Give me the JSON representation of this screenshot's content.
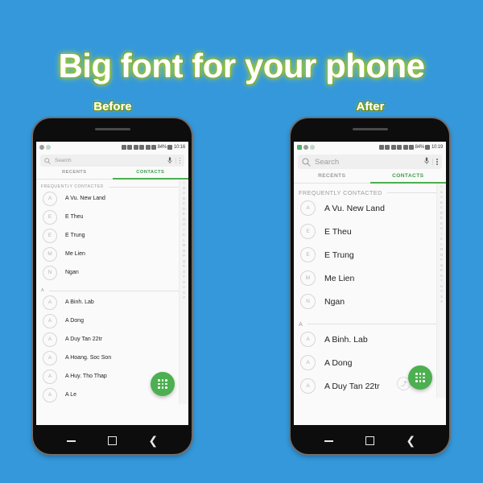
{
  "banner": {
    "title": "Big font for your phone",
    "background_color": "#3498db",
    "title_color": "#ffffff",
    "title_glow_color": "#9acd32"
  },
  "captions": {
    "before": "Before",
    "after": "After"
  },
  "phones": [
    {
      "id": "before",
      "caption": "Before",
      "status_bar": {
        "battery": "84%",
        "time": "10:16",
        "left_icons": [
          "sim-icon",
          "battery-saver-icon"
        ],
        "right_icons": [
          "no-sound-icon",
          "settings-icon",
          "wifi-icon",
          "sd-card-icon",
          "screenshot-icon",
          "signal-icon"
        ]
      },
      "search": {
        "placeholder": "Search",
        "icons": [
          "search-icon",
          "mic-icon",
          "overflow-menu-icon"
        ]
      },
      "tabs": [
        {
          "label": "RECENTS",
          "active": false
        },
        {
          "label": "CONTACTS",
          "active": true
        }
      ],
      "accent_color": "#4caf50",
      "sections": [
        {
          "header": "FREQUENTLY CONTACTED",
          "contacts": [
            {
              "initial": "A",
              "name": "A Vu. New Land"
            },
            {
              "initial": "E",
              "name": "E Theu"
            },
            {
              "initial": "E",
              "name": "E Trung"
            },
            {
              "initial": "M",
              "name": "Me Lien"
            },
            {
              "initial": "N",
              "name": "Ngan"
            }
          ]
        },
        {
          "header": "A",
          "contacts": [
            {
              "initial": "A",
              "name": "A Binh. Lab"
            },
            {
              "initial": "A",
              "name": "A Dong"
            },
            {
              "initial": "A",
              "name": "A Duy Tan 22tr"
            },
            {
              "initial": "A",
              "name": "A Hoang. Soc Son"
            },
            {
              "initial": "A",
              "name": "A Huy. Tho Thap"
            },
            {
              "initial": "A",
              "name": "A Le"
            }
          ]
        }
      ],
      "alpha_index": [
        "☆",
        "&",
        "A",
        "B",
        "C",
        "D",
        "E",
        "G",
        "H",
        "I",
        "K",
        "L",
        "M",
        "N",
        "P",
        "Q",
        "R",
        "S",
        "T",
        "U",
        "V",
        "X",
        "#"
      ],
      "fab": {
        "icon": "dialpad-icon",
        "color": "#4caf50"
      },
      "nav_bar": [
        "recents-button",
        "home-button",
        "back-button"
      ],
      "scroll_pill": null
    },
    {
      "id": "after",
      "caption": "After",
      "status_bar": {
        "battery": "84%",
        "time": "10:19",
        "left_icons": [
          "app-icon",
          "sim-icon",
          "battery-saver-icon"
        ],
        "right_icons": [
          "no-sound-icon",
          "settings-icon",
          "wifi-icon",
          "sd-card-icon",
          "screenshot-icon",
          "signal-icon"
        ]
      },
      "search": {
        "placeholder": "Search",
        "icons": [
          "search-icon",
          "mic-icon",
          "overflow-menu-icon"
        ]
      },
      "tabs": [
        {
          "label": "RECENTS",
          "active": false
        },
        {
          "label": "CONTACTS",
          "active": true
        }
      ],
      "accent_color": "#4caf50",
      "sections": [
        {
          "header": "FREQUENTLY CONTACTED",
          "contacts": [
            {
              "initial": "A",
              "name": "A Vu. New Land"
            },
            {
              "initial": "E",
              "name": "E Theu"
            },
            {
              "initial": "E",
              "name": "E Trung"
            },
            {
              "initial": "M",
              "name": "Me Lien"
            },
            {
              "initial": "N",
              "name": "Ngan"
            }
          ]
        },
        {
          "header": "A",
          "contacts": [
            {
              "initial": "A",
              "name": "A Binh. Lab"
            },
            {
              "initial": "A",
              "name": "A Dong"
            },
            {
              "initial": "A",
              "name": "A Duy Tan 22tr"
            }
          ]
        }
      ],
      "alpha_index": [
        "☆",
        "&",
        "A",
        "B",
        "C",
        "D",
        "E",
        "G",
        "H",
        "I",
        "K",
        "L",
        "M",
        "N",
        "P",
        "Q",
        "R",
        "S",
        "T",
        "U",
        "V",
        "X",
        "#"
      ],
      "fab": {
        "icon": "dialpad-icon",
        "color": "#4caf50"
      },
      "nav_bar": [
        "recents-button",
        "home-button",
        "back-button"
      ],
      "scroll_pill": "⤴"
    }
  ]
}
